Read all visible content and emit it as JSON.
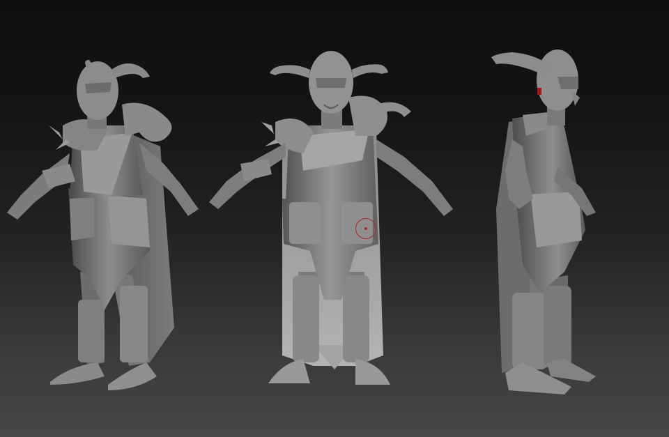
{
  "scene": {
    "views": [
      "front-three-quarter",
      "front",
      "side"
    ],
    "background": {
      "top": "#0e0e0e",
      "bottom": "#464646"
    },
    "material": {
      "base": "#7a7a7a",
      "light": "#a8a8a8",
      "shadow": "#3e3e3e"
    },
    "cursor_color": "#b0262a"
  }
}
